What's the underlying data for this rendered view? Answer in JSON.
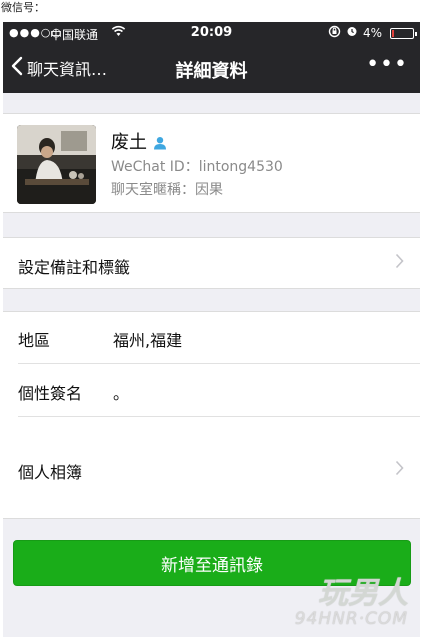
{
  "caption": "微信号：",
  "status_bar": {
    "signal": "●●●○○",
    "carrier": "中国联通",
    "time": "20:09",
    "battery_percent": "4%",
    "battery_level": 0.04
  },
  "nav": {
    "back_label": "聊天資訊…",
    "title": "詳細資料",
    "more_label": "•••"
  },
  "profile": {
    "name": "废土",
    "wechat_id": "WeChat ID：lintong4530",
    "group_nickname": "聊天室暱稱：因果"
  },
  "remark_row": {
    "label": "設定備註和標籤"
  },
  "info": {
    "region_label": "地區",
    "region_value": "福州,福建",
    "signature_label": "個性簽名",
    "signature_value": "。",
    "album_label": "個人相簿"
  },
  "add_button_label": "新增至通訊錄",
  "watermark": {
    "text": "玩男人",
    "url": "94HNR·COM"
  },
  "colors": {
    "bar_bg": "#262629",
    "page_bg": "#efeff4",
    "button_green": "#1aad19",
    "user_icon_blue": "#3fa7e0"
  },
  "icons": {
    "back": "chevron-left-icon",
    "more": "more-dots-icon",
    "user": "user-profile-icon",
    "disclosure": "chevron-right-icon"
  }
}
